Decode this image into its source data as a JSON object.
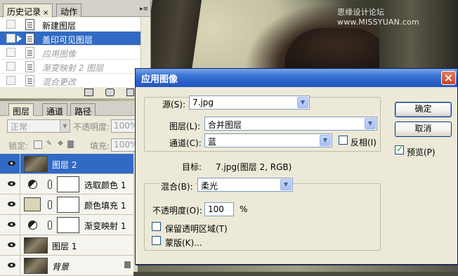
{
  "watermark": "思缘设计论坛 www.MISSYUAN.com",
  "history_panel": {
    "tabs": [
      {
        "label": "历史记录",
        "close": "×"
      },
      {
        "label": "动作"
      }
    ],
    "menu_icon": "panel-menu-icon",
    "items": [
      {
        "label": "新建图层",
        "state": "normal"
      },
      {
        "label": "盖印可见图层",
        "state": "selected"
      },
      {
        "label": "应用图像",
        "state": "disabled"
      },
      {
        "label": "渐变映射 2 图层",
        "state": "disabled"
      },
      {
        "label": "混合更改",
        "state": "disabled"
      }
    ]
  },
  "layers_panel": {
    "tabs": [
      {
        "label": "图层"
      },
      {
        "label": "通道"
      },
      {
        "label": "路径"
      }
    ],
    "blend_mode": "正常",
    "opacity_label": "不透明度:",
    "opacity_value": "100%",
    "lock_label": "锁定:",
    "fill_label": "填充:",
    "fill_value": "100%",
    "layers": [
      {
        "name": "图层 2",
        "kind": "photo",
        "selected": true
      },
      {
        "name": "选取颜色 1",
        "kind": "adjustment"
      },
      {
        "name": "颜色填充 1",
        "kind": "fill"
      },
      {
        "name": "渐变映射 1",
        "kind": "adjustment"
      },
      {
        "name": "图层 1",
        "kind": "photo"
      },
      {
        "name": "背景",
        "kind": "photo",
        "locked": true
      }
    ]
  },
  "dialog": {
    "title": "应用图像",
    "close": "×",
    "source_label": "源(S):",
    "source_value": "7.jpg",
    "layer_label": "图层(L):",
    "layer_value": "合并图层",
    "channel_label": "通道(C):",
    "channel_value": "蓝",
    "invert_label": "反相(I)",
    "invert_checked": false,
    "target_label": "目标:",
    "target_value": "7.jpg(图层 2, RGB)",
    "blending_label": "混合(B):",
    "blending_value": "柔光",
    "opacity_label": "不透明度(O):",
    "opacity_value": "100",
    "opacity_unit": "%",
    "preserve_label": "保留透明区域(T)",
    "preserve_checked": false,
    "mask_label": "蒙版(K)...",
    "mask_checked": false,
    "ok_label": "确定",
    "cancel_label": "取消",
    "preview_label": "预览(P)",
    "preview_checked": true
  }
}
